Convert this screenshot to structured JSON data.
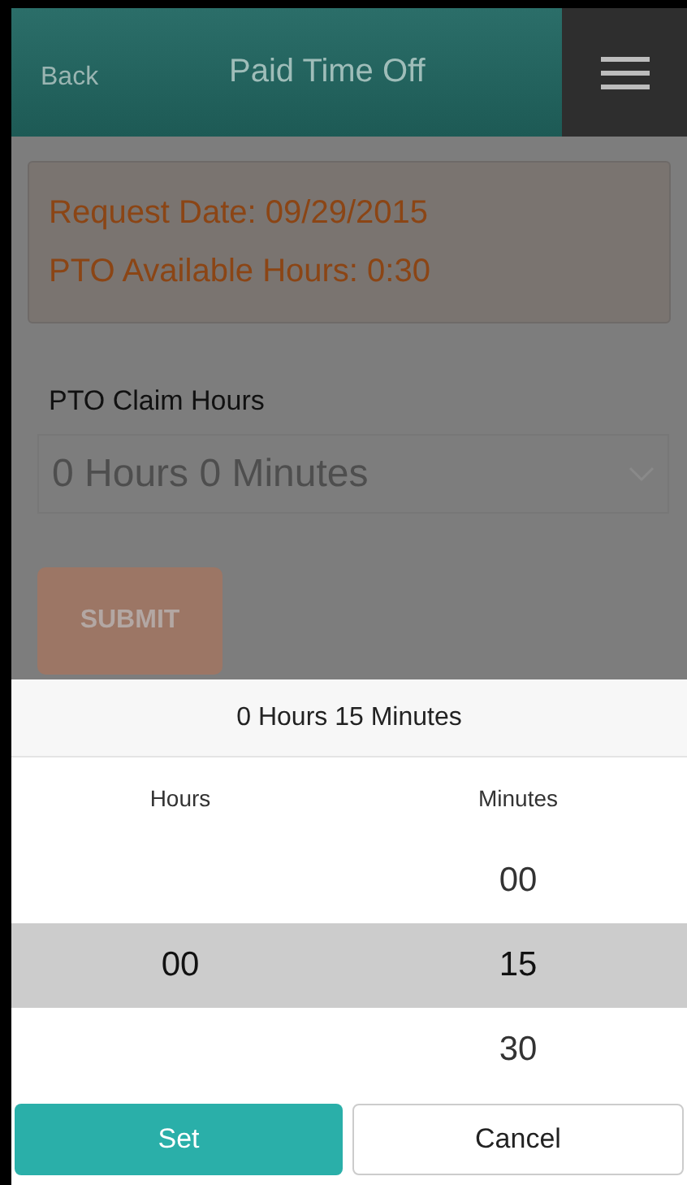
{
  "header": {
    "back": "Back",
    "title": "Paid Time Off"
  },
  "info": [
    "Request Date: 09/29/2015",
    "PTO Available Hours: 0:30"
  ],
  "claim": {
    "label": "PTO Claim Hours",
    "value": "0 Hours 0 Minutes"
  },
  "submit": {
    "label": "SUBMIT",
    "disabled": true
  },
  "picker": {
    "summary": "0 Hours 15 Minutes",
    "columns": [
      {
        "label": "Hours",
        "items": [
          {
            "value": "00",
            "selected": true
          }
        ]
      },
      {
        "label": "Minutes",
        "items": [
          {
            "value": "00",
            "selected": false
          },
          {
            "value": "15",
            "selected": true
          },
          {
            "value": "30",
            "selected": false
          }
        ]
      }
    ],
    "buttons": [
      {
        "label": "Set",
        "kind": "primary"
      },
      {
        "label": "Cancel",
        "kind": "secondary"
      }
    ]
  }
}
